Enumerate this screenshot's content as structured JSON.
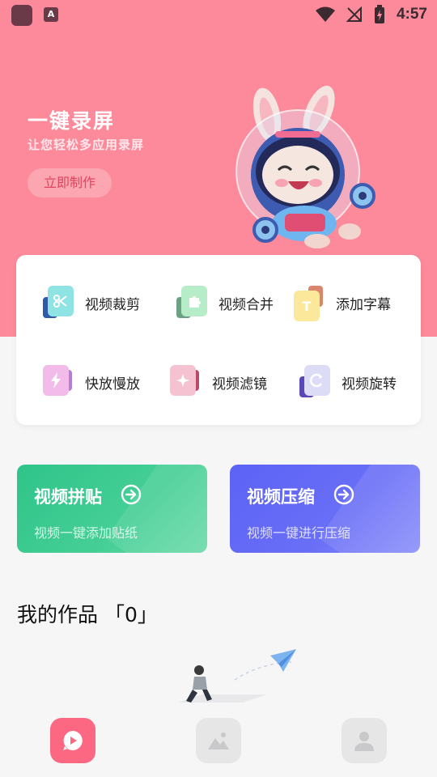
{
  "status_bar": {
    "notif_app_letter": "A",
    "time": "4:57"
  },
  "hero": {
    "title": "一键录屏",
    "subtitle": "让您轻松多应用录屏",
    "button_label": "立即制作"
  },
  "tools": [
    {
      "label": "视频裁剪",
      "icon": "scissors-icon",
      "front_color": "#8fe3e2",
      "back_color": "#2f5aa8"
    },
    {
      "label": "视频合并",
      "icon": "puzzle-icon",
      "front_color": "#b7ecc8",
      "back_color": "#6aa083"
    },
    {
      "label": "添加字幕",
      "icon": "text-icon",
      "front_color": "#fbe89a",
      "back_color": "#d9866c"
    },
    {
      "label": "快放慢放",
      "icon": "lightning-icon",
      "front_color": "#f3bbea",
      "back_color": "#b17fd8"
    },
    {
      "label": "视频滤镜",
      "icon": "sparkle-icon",
      "front_color": "#f5c2d1",
      "back_color": "#b94a6a"
    },
    {
      "label": "视频旋转",
      "icon": "rotate-icon",
      "front_color": "#dcdcf6",
      "back_color": "#5b46b8"
    }
  ],
  "features": [
    {
      "title": "视频拼贴",
      "subtitle": "视频一键添加贴纸",
      "color": "#34c88c"
    },
    {
      "title": "视频压缩",
      "subtitle": "视频一键进行压缩",
      "color": "#5f65f6"
    }
  ],
  "works": {
    "title": "我的作品 「0」"
  },
  "tabbar": [
    {
      "icon": "video-play-icon",
      "active": true
    },
    {
      "icon": "image-icon",
      "active": false
    },
    {
      "icon": "user-icon",
      "active": false
    }
  ],
  "colors": {
    "hero_bg": "#fd8a9a",
    "accent": "#fc6782"
  }
}
